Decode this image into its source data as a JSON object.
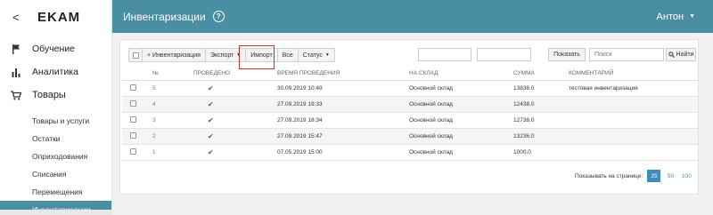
{
  "brand": {
    "back_glyph": "<",
    "logo": "EKAM"
  },
  "nav": [
    {
      "label": "Обучение",
      "icon": "flag-icon"
    },
    {
      "label": "Аналитика",
      "icon": "bar-chart-icon"
    },
    {
      "label": "Товары",
      "icon": "cart-icon"
    }
  ],
  "subnav": [
    {
      "label": "Товары и услуги"
    },
    {
      "label": "Остатки"
    },
    {
      "label": "Оприходования"
    },
    {
      "label": "Списания"
    },
    {
      "label": "Перемещения"
    },
    {
      "label": "Инвентаризации",
      "active": true
    }
  ],
  "header": {
    "title": "Инвентаризации",
    "help": "?",
    "user": "Антон",
    "color": "#4a8ea3"
  },
  "toolbar": {
    "add": "+ Инвентаризация",
    "export": "Экспорт",
    "import": "Импорт",
    "all": "Все",
    "status": "Статус",
    "show": "Показать",
    "search_placeholder": "Поиск",
    "find": "Найти"
  },
  "table": {
    "headers": [
      "№",
      "ПРОВЕДЕНО",
      "ВРЕМЯ ПРОВЕДЕНИЯ",
      "НА СКЛАД",
      "СУММА",
      "КОММЕНТАРИЙ"
    ],
    "rows": [
      {
        "no": "5",
        "done": "✔",
        "time": "30.09.2019 10:49",
        "warehouse": "Основной склад",
        "sum": "13838.0",
        "comment": "тестовая инвентаризация"
      },
      {
        "no": "4",
        "done": "✔",
        "time": "27.09.2019 19:33",
        "warehouse": "Основной склад",
        "sum": "12438.0",
        "comment": ""
      },
      {
        "no": "3",
        "done": "✔",
        "time": "27.09.2019 18:34",
        "warehouse": "Основной склад",
        "sum": "12738.0",
        "comment": ""
      },
      {
        "no": "2",
        "done": "✔",
        "time": "27.09.2019 15:47",
        "warehouse": "Основной склад",
        "sum": "13236.0",
        "comment": ""
      },
      {
        "no": "1",
        "done": "✔",
        "time": "07.05.2019 15:00",
        "warehouse": "Основной склад",
        "sum": "1000.0",
        "comment": ""
      }
    ]
  },
  "pager": {
    "label": "Показывать на странице:",
    "sizes": [
      "25",
      "50",
      "100"
    ],
    "active": "25"
  }
}
